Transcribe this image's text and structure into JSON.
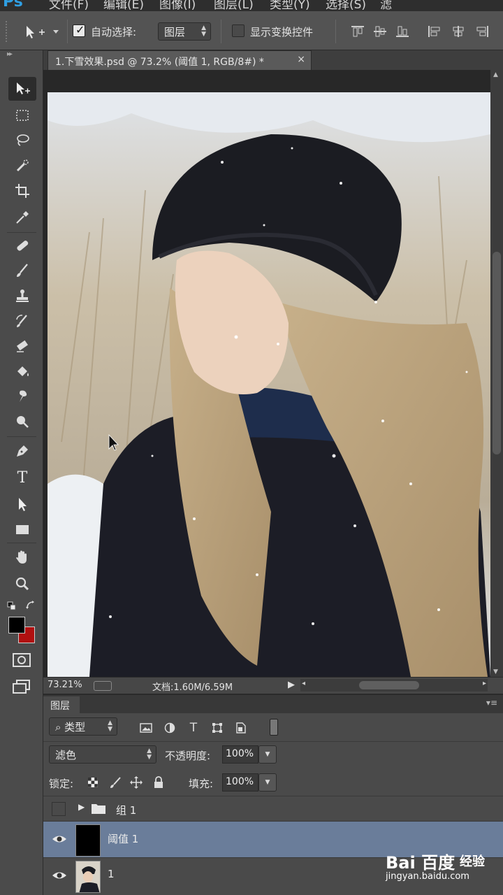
{
  "menubar": {
    "logo": "Ps",
    "items": [
      "文件(F)",
      "编辑(E)",
      "图像(I)",
      "图层(L)",
      "类型(Y)",
      "选择(S)",
      "滤"
    ]
  },
  "options_bar": {
    "auto_select_label": "自动选择:",
    "auto_select_checked": true,
    "auto_select_target": "图层",
    "show_transform_label": "显示变换控件",
    "show_transform_checked": false,
    "align_icons": [
      "align-top-edges-icon",
      "align-vertical-centers-icon",
      "align-bottom-edges-icon",
      "align-left-edges-icon",
      "align-horizontal-centers-icon",
      "align-right-edges-icon"
    ]
  },
  "document_tab": {
    "title": "1.下雪效果.psd @ 73.2% (阈值 1, RGB/8#) *",
    "close_glyph": "×"
  },
  "toolbox": {
    "tools": [
      "move-tool",
      "marquee-tool",
      "lasso-tool",
      "quick-selection-tool",
      "crop-tool",
      "eyedropper-tool",
      "healing-brush-tool",
      "brush-tool",
      "clone-stamp-tool",
      "history-brush-tool",
      "eraser-tool",
      "paint-bucket-tool",
      "blur-tool",
      "dodge-tool",
      "pen-tool",
      "type-tool",
      "path-selection-tool",
      "rectangle-tool",
      "hand-tool",
      "zoom-tool"
    ],
    "active_tool": "move-tool",
    "type_tool_glyph": "T",
    "foreground_color": "#000000",
    "background_color": "#b01010"
  },
  "status_bar": {
    "zoom": "73.21%",
    "doc_info": "文档:1.60M/6.59M"
  },
  "layers_panel": {
    "tab_label": "图层",
    "filter_kind": "类型",
    "filter_icons": [
      "image-filter-icon",
      "adjustment-filter-icon",
      "type-filter-icon",
      "shape-filter-icon",
      "smart-object-filter-icon"
    ],
    "filter_type_glyph": "T",
    "blend_mode": "滤色",
    "opacity_label": "不透明度:",
    "opacity_value": "100%",
    "lock_label": "锁定:",
    "fill_label": "填充:",
    "fill_value": "100%",
    "layers": [
      {
        "name": "组 1",
        "type": "group",
        "visible": false,
        "selected": false
      },
      {
        "name": "阈值 1",
        "type": "layer",
        "visible": true,
        "selected": true
      },
      {
        "name": "1",
        "type": "layer",
        "visible": true,
        "selected": false
      }
    ]
  },
  "watermark": {
    "brand": "Bai 百度",
    "brand_cn": "经验",
    "url": "jingyan.baidu.com"
  },
  "colors": {
    "accent_blue": "#2f9fe3",
    "selected_layer": "#6a7d9a",
    "panel_bg": "#4a4a4a"
  }
}
